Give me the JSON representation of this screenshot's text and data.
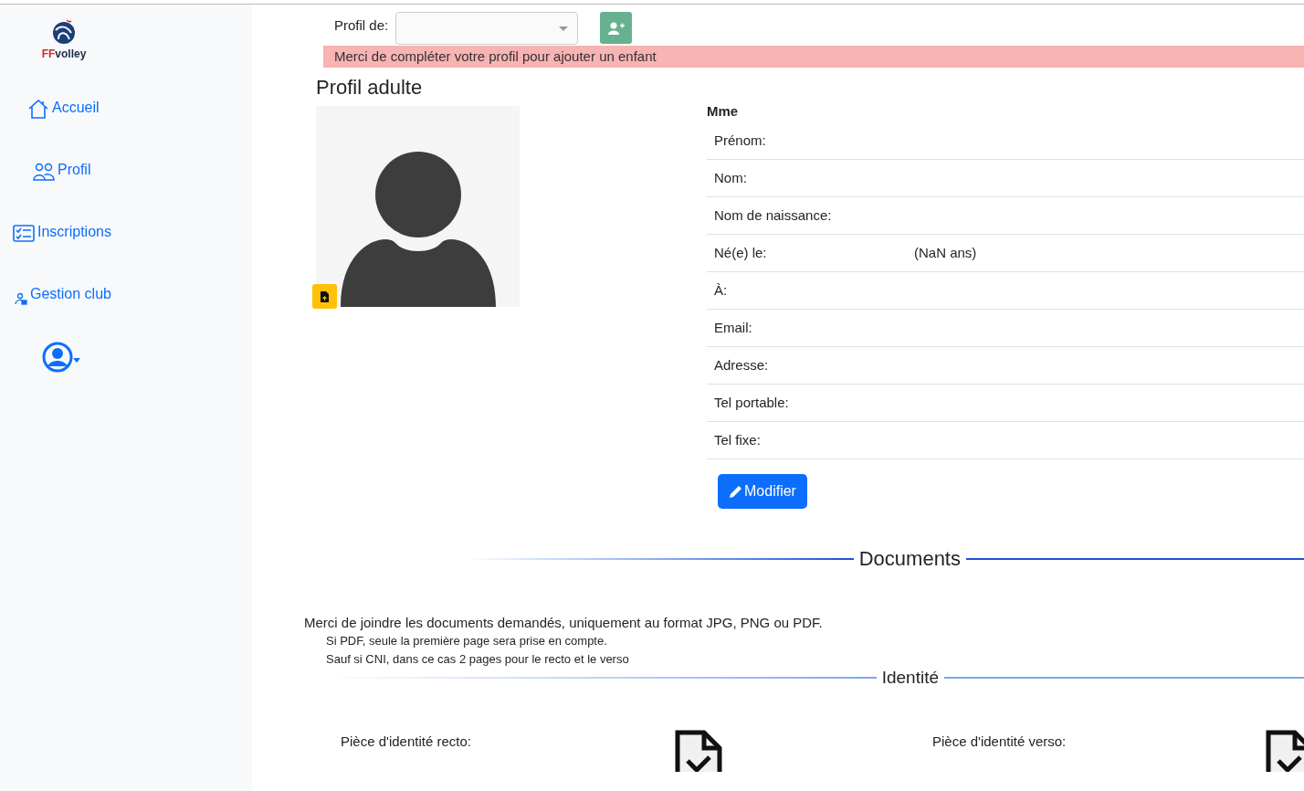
{
  "sidebar": {
    "logo": {
      "prefix": "FF",
      "name": "volley"
    },
    "items": [
      {
        "kind": "home",
        "label": "Accueil"
      },
      {
        "kind": "people",
        "label": "Profil"
      },
      {
        "kind": "checklist",
        "label": "Inscriptions"
      },
      {
        "kind": "lock-user",
        "label": "Gestion club"
      }
    ]
  },
  "profile_selector": {
    "label": "Profil de:"
  },
  "alert": "Merci de compléter votre profil pour ajouter un enfant",
  "profile": {
    "title": "Profil adulte",
    "civility": "Mme",
    "fields": [
      {
        "label": "Prénom:"
      },
      {
        "label": "Nom:"
      },
      {
        "label": "Nom de naissance:"
      },
      {
        "label": "Né(e) le:",
        "extra": "(NaN ans)"
      },
      {
        "label": "À:"
      },
      {
        "label": "Email:"
      },
      {
        "label": "Adresse:"
      },
      {
        "label": "Tel portable:"
      },
      {
        "label": "Tel fixe:"
      }
    ],
    "edit_button": "Modifier"
  },
  "documents": {
    "title": "Documents",
    "intro": "Merci de joindre les documents demandés, uniquement au format JPG, PNG ou PDF.",
    "notes": [
      "Si PDF, seule la première page sera prise en compte.",
      "Sauf si CNI, dans ce cas 2 pages pour le recto et le verso"
    ],
    "section": "Identité",
    "items": [
      {
        "label": "Pièce d'identité recto:"
      },
      {
        "label": "Pièce d'identité verso:"
      }
    ]
  }
}
